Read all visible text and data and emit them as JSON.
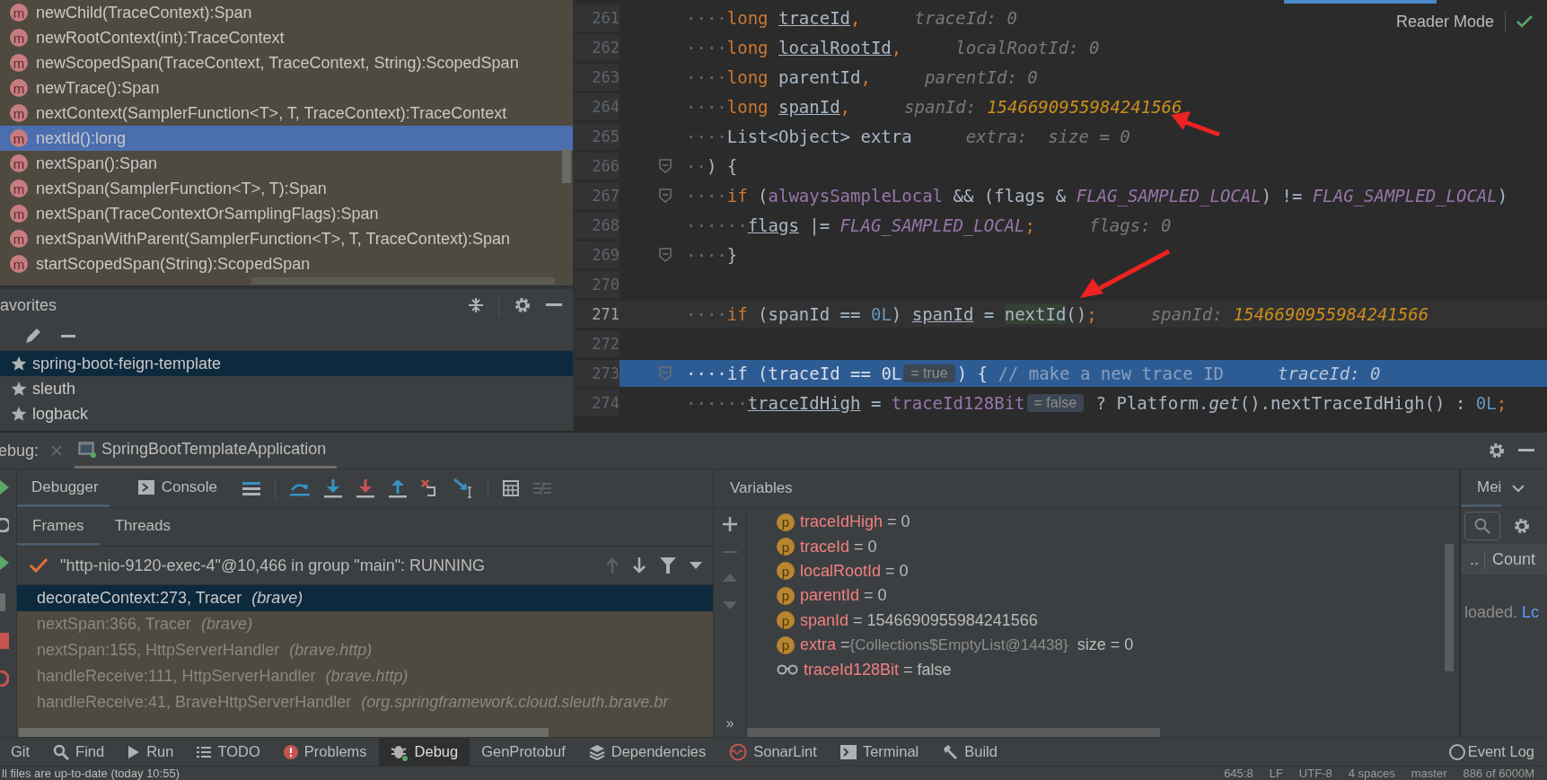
{
  "structure": {
    "items": [
      {
        "icon": "m",
        "label": "newChild(TraceContext):Span",
        "selected": false
      },
      {
        "icon": "m",
        "label": "newRootContext(int):TraceContext",
        "selected": false
      },
      {
        "icon": "m",
        "label": "newScopedSpan(TraceContext, TraceContext, String):ScopedSpan",
        "selected": false
      },
      {
        "icon": "m",
        "label": "newTrace():Span",
        "selected": false
      },
      {
        "icon": "m",
        "label": "nextContext(SamplerFunction<T>, T, TraceContext):TraceContext",
        "selected": false
      },
      {
        "icon": "m",
        "label": "nextId():long",
        "selected": true
      },
      {
        "icon": "m",
        "label": "nextSpan():Span",
        "selected": false
      },
      {
        "icon": "m",
        "label": "nextSpan(SamplerFunction<T>, T):Span",
        "selected": false
      },
      {
        "icon": "m",
        "label": "nextSpan(TraceContextOrSamplingFlags):Span",
        "selected": false
      },
      {
        "icon": "m",
        "label": "nextSpanWithParent(SamplerFunction<T>, T, TraceContext):Span",
        "selected": false
      },
      {
        "icon": "m",
        "label": "startScopedSpan(String):ScopedSpan",
        "selected": false
      }
    ]
  },
  "favorites": {
    "title": "avorites",
    "items": [
      {
        "label": "spring-boot-feign-template",
        "selected": true
      },
      {
        "label": "sleuth",
        "selected": false
      },
      {
        "label": "logback",
        "selected": false
      }
    ]
  },
  "editor": {
    "reader_mode": "Reader Mode",
    "lines": [
      {
        "number": "261",
        "fold": false,
        "current": false,
        "selected": false,
        "segments": [
          {
            "kind": "ws",
            "text": "····"
          },
          {
            "kind": "kw",
            "text": "long "
          },
          {
            "kind": "ul",
            "text": "traceId"
          },
          {
            "kind": "kw",
            "text": ","
          },
          {
            "kind": "hint",
            "text": "traceId: 0"
          }
        ]
      },
      {
        "number": "262",
        "fold": false,
        "current": false,
        "selected": false,
        "segments": [
          {
            "kind": "ws",
            "text": "····"
          },
          {
            "kind": "kw",
            "text": "long "
          },
          {
            "kind": "ul",
            "text": "localRootId"
          },
          {
            "kind": "kw",
            "text": ","
          },
          {
            "kind": "hint",
            "text": "localRootId: 0"
          }
        ]
      },
      {
        "number": "263",
        "fold": false,
        "current": false,
        "selected": false,
        "segments": [
          {
            "kind": "ws",
            "text": "····"
          },
          {
            "kind": "kw",
            "text": "long"
          },
          {
            "kind": "plain",
            "text": " parentId"
          },
          {
            "kind": "kw",
            "text": ","
          },
          {
            "kind": "hint",
            "text": "parentId: 0"
          }
        ]
      },
      {
        "number": "264",
        "fold": false,
        "current": false,
        "selected": false,
        "segments": [
          {
            "kind": "ws",
            "text": "····"
          },
          {
            "kind": "kw",
            "text": "long "
          },
          {
            "kind": "ul",
            "text": "spanId"
          },
          {
            "kind": "kw",
            "text": ","
          },
          {
            "kind": "hint",
            "text": "spanId:"
          },
          {
            "kind": "hintval",
            "text": "1546690955984241566"
          }
        ]
      },
      {
        "number": "265",
        "fold": false,
        "current": false,
        "selected": false,
        "segments": [
          {
            "kind": "ws",
            "text": "····"
          },
          {
            "kind": "plain",
            "text": "List<Object> extra"
          },
          {
            "kind": "hint",
            "text": "extra:  size = 0"
          }
        ]
      },
      {
        "number": "266",
        "fold": true,
        "current": false,
        "selected": false,
        "segments": [
          {
            "kind": "ws",
            "text": "··"
          },
          {
            "kind": "plain",
            "text": ") {"
          }
        ]
      },
      {
        "number": "267",
        "fold": true,
        "current": false,
        "selected": false,
        "segments": [
          {
            "kind": "ws",
            "text": "····"
          },
          {
            "kind": "kw",
            "text": "if"
          },
          {
            "kind": "plain",
            "text": " ("
          },
          {
            "kind": "field",
            "text": "alwaysSampleLocal"
          },
          {
            "kind": "plain",
            "text": " && (flags & "
          },
          {
            "kind": "const",
            "text": "FLAG_SAMPLED_LOCAL"
          },
          {
            "kind": "plain",
            "text": ") != "
          },
          {
            "kind": "const",
            "text": "FLAG_SAMPLED_LOCAL"
          },
          {
            "kind": "plain",
            "text": ")"
          }
        ]
      },
      {
        "number": "268",
        "fold": false,
        "current": false,
        "selected": false,
        "segments": [
          {
            "kind": "ws",
            "text": "······"
          },
          {
            "kind": "ul",
            "text": "flags"
          },
          {
            "kind": "plain",
            "text": " |= "
          },
          {
            "kind": "const",
            "text": "FLAG_SAMPLED_LOCAL"
          },
          {
            "kind": "kw",
            "text": ";"
          },
          {
            "kind": "hint",
            "text": "flags: 0"
          }
        ]
      },
      {
        "number": "269",
        "fold": true,
        "current": false,
        "selected": false,
        "segments": [
          {
            "kind": "ws",
            "text": "····"
          },
          {
            "kind": "plain",
            "text": "}"
          }
        ]
      },
      {
        "number": "270",
        "fold": false,
        "current": false,
        "selected": false
      },
      {
        "number": "271",
        "fold": false,
        "current": true,
        "selected": false,
        "segments": [
          {
            "kind": "ws",
            "text": "····"
          },
          {
            "kind": "kw",
            "text": "if"
          },
          {
            "kind": "plain",
            "text": " (spanId == "
          },
          {
            "kind": "num",
            "text": "0L"
          },
          {
            "kind": "plain",
            "text": ") "
          },
          {
            "kind": "ul",
            "text": "spanId"
          },
          {
            "kind": "plain",
            "text": " = "
          },
          {
            "kind": "call",
            "text": "nextId"
          },
          {
            "kind": "plain",
            "text": "()"
          },
          {
            "kind": "kw",
            "text": ";"
          },
          {
            "kind": "hint",
            "text": "spanId:"
          },
          {
            "kind": "hintval",
            "text": "1546690955984241566"
          }
        ]
      },
      {
        "number": "272",
        "fold": false,
        "current": false,
        "selected": false
      },
      {
        "number": "273",
        "fold": true,
        "current": false,
        "selected": true,
        "segments": [
          {
            "kind": "ws",
            "text": "····"
          },
          {
            "kind": "kw",
            "text": "if"
          },
          {
            "kind": "plain",
            "text": " (traceId == "
          },
          {
            "kind": "num",
            "text": "0L"
          },
          {
            "kind": "inlay",
            "text": "= true"
          },
          {
            "kind": "plain",
            "text": ") { "
          },
          {
            "kind": "comment",
            "text": "// make a new trace ID"
          },
          {
            "kind": "hint",
            "text": "traceId: 0"
          }
        ]
      },
      {
        "number": "274",
        "fold": false,
        "current": false,
        "selected": false,
        "segments": [
          {
            "kind": "ws",
            "text": "······"
          },
          {
            "kind": "ul",
            "text": "traceIdHigh"
          },
          {
            "kind": "plain",
            "text": " = "
          },
          {
            "kind": "field",
            "text": "traceId128Bit"
          },
          {
            "kind": "inlay",
            "text": "= false"
          },
          {
            "kind": "plain",
            "text": " ? Platform."
          },
          {
            "kind": "italic",
            "text": "get"
          },
          {
            "kind": "plain",
            "text": "().nextTraceIdHigh() : "
          },
          {
            "kind": "num",
            "text": "0L"
          },
          {
            "kind": "kw",
            "text": ";"
          }
        ]
      }
    ]
  },
  "debug": {
    "label": "ebug:",
    "config": "SpringBootTemplateApplication",
    "tabs": [
      {
        "label": "Debugger",
        "selected": true
      },
      {
        "label": "Console",
        "selected": false
      }
    ],
    "frame_tabs": [
      {
        "label": "Frames",
        "selected": true
      },
      {
        "label": "Threads",
        "selected": false
      }
    ],
    "thread": "\"http-nio-9120-exec-4\"@10,466 in group \"main\": RUNNING",
    "frames": [
      {
        "method": "decorateContext:273, Tracer",
        "package": "(brave)",
        "selected": true
      },
      {
        "method": "nextSpan:366, Tracer",
        "package": "(brave)",
        "selected": false
      },
      {
        "method": "nextSpan:155, HttpServerHandler",
        "package": "(brave.http)",
        "selected": false
      },
      {
        "method": "handleReceive:111, HttpServerHandler",
        "package": "(brave.http)",
        "selected": false
      },
      {
        "method": "handleReceive:41, BraveHttpServerHandler",
        "package": "(org.springframework.cloud.sleuth.brave.br",
        "selected": false
      }
    ],
    "variables_title": "Variables",
    "more": "»",
    "variables": [
      {
        "kind": "field",
        "icon": "p",
        "name": "traceIdHigh",
        "value": "= 0"
      },
      {
        "kind": "field",
        "icon": "p",
        "name": "traceId",
        "value": "= 0"
      },
      {
        "kind": "field",
        "icon": "p",
        "name": "localRootId",
        "value": "= 0"
      },
      {
        "kind": "field",
        "icon": "p",
        "name": "parentId",
        "value": "= 0"
      },
      {
        "kind": "field",
        "icon": "p",
        "name": "spanId",
        "value": "= 1546690955984241566"
      },
      {
        "kind": "field",
        "icon": "p",
        "name": "extra",
        "value": "=",
        "ref": "{Collections$EmptyList@14438}",
        "note": "size = 0"
      },
      {
        "kind": "watch",
        "name": "traceId128Bit",
        "value": "= false"
      }
    ]
  },
  "memory": {
    "tab": "Mei",
    "column_1": "..",
    "column_2": "Count",
    "message": "loaded.",
    "link": "Lc"
  },
  "tool_windows": [
    {
      "kind": "git",
      "label": "Git",
      "selected": false
    },
    {
      "kind": "find",
      "label": "Find",
      "selected": false
    },
    {
      "kind": "run",
      "label": "Run",
      "selected": false
    },
    {
      "kind": "todo",
      "label": "TODO",
      "selected": false
    },
    {
      "kind": "problems",
      "label": "Problems",
      "selected": false
    },
    {
      "kind": "debug",
      "label": "Debug",
      "selected": true
    },
    {
      "kind": "plain",
      "label": "GenProtobuf",
      "selected": false
    },
    {
      "kind": "dependencies",
      "label": "Dependencies",
      "selected": false
    },
    {
      "kind": "sonarlint",
      "label": "SonarLint",
      "selected": false
    },
    {
      "kind": "terminal",
      "label": "Terminal",
      "selected": false
    },
    {
      "kind": "build",
      "label": "Build",
      "selected": false
    }
  ],
  "event_log": "Event Log",
  "status_bar": {
    "message": "ll files are up-to-date (today 10:55)",
    "items": [
      "645:8",
      "LF",
      "UTF-8",
      "4 spaces",
      "master",
      "886 of 6000M"
    ]
  }
}
